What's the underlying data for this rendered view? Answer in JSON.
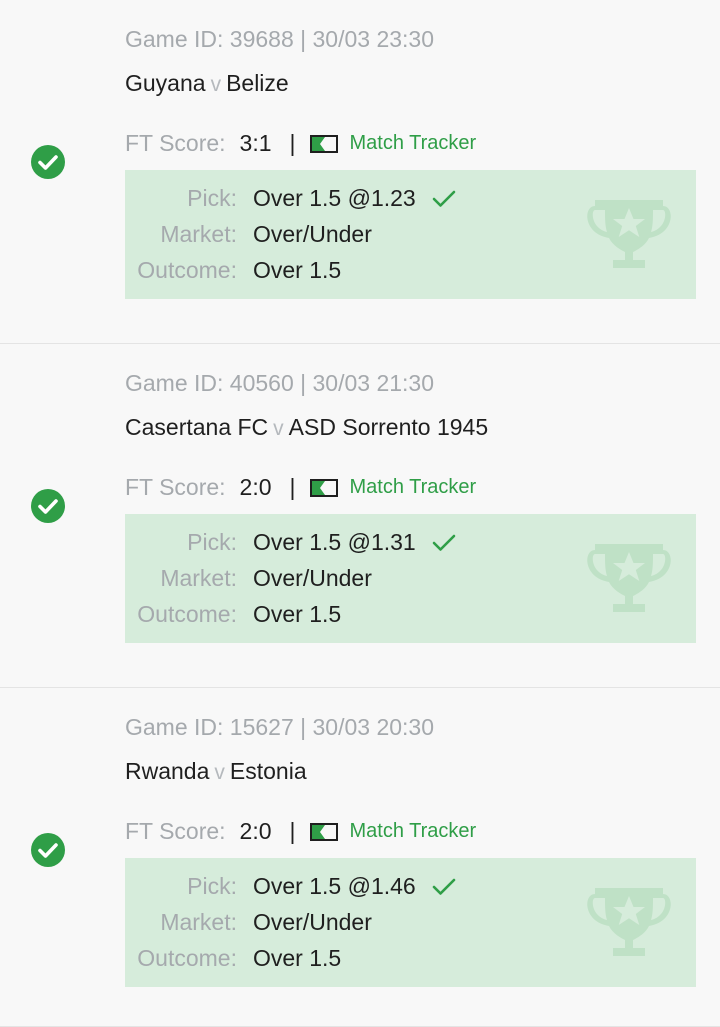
{
  "colors": {
    "success": "#2f9e47",
    "pick_bg": "#d6ecdb",
    "muted": "#a5a9ad",
    "text": "#1f1f1f"
  },
  "icons": {
    "status": "check-circle-icon",
    "tracker": "match-tracker-icon",
    "pick_result": "checkmark-icon",
    "watermark": "trophy-icon"
  },
  "bets": [
    {
      "game_meta": "Game ID: 39688 | 30/03 23:30",
      "home": "Guyana",
      "vs": "v",
      "away": "Belize",
      "score_label": "FT Score:",
      "score": "3:1",
      "separator": "|",
      "tracker_label": "Match Tracker",
      "pick_label": "Pick:",
      "pick": "Over 1.5 @1.23",
      "market_label": "Market:",
      "market": "Over/Under",
      "outcome_label": "Outcome:",
      "outcome": "Over 1.5"
    },
    {
      "game_meta": "Game ID: 40560 | 30/03 21:30",
      "home": "Casertana FC",
      "vs": "v",
      "away": "ASD Sorrento 1945",
      "score_label": "FT Score:",
      "score": "2:0",
      "separator": "|",
      "tracker_label": "Match Tracker",
      "pick_label": "Pick:",
      "pick": "Over 1.5 @1.31",
      "market_label": "Market:",
      "market": "Over/Under",
      "outcome_label": "Outcome:",
      "outcome": "Over 1.5"
    },
    {
      "game_meta": "Game ID: 15627 | 30/03 20:30",
      "home": "Rwanda",
      "vs": "v",
      "away": "Estonia",
      "score_label": "FT Score:",
      "score": "2:0",
      "separator": "|",
      "tracker_label": "Match Tracker",
      "pick_label": "Pick:",
      "pick": "Over 1.5 @1.46",
      "market_label": "Market:",
      "market": "Over/Under",
      "outcome_label": "Outcome:",
      "outcome": "Over 1.5"
    }
  ]
}
